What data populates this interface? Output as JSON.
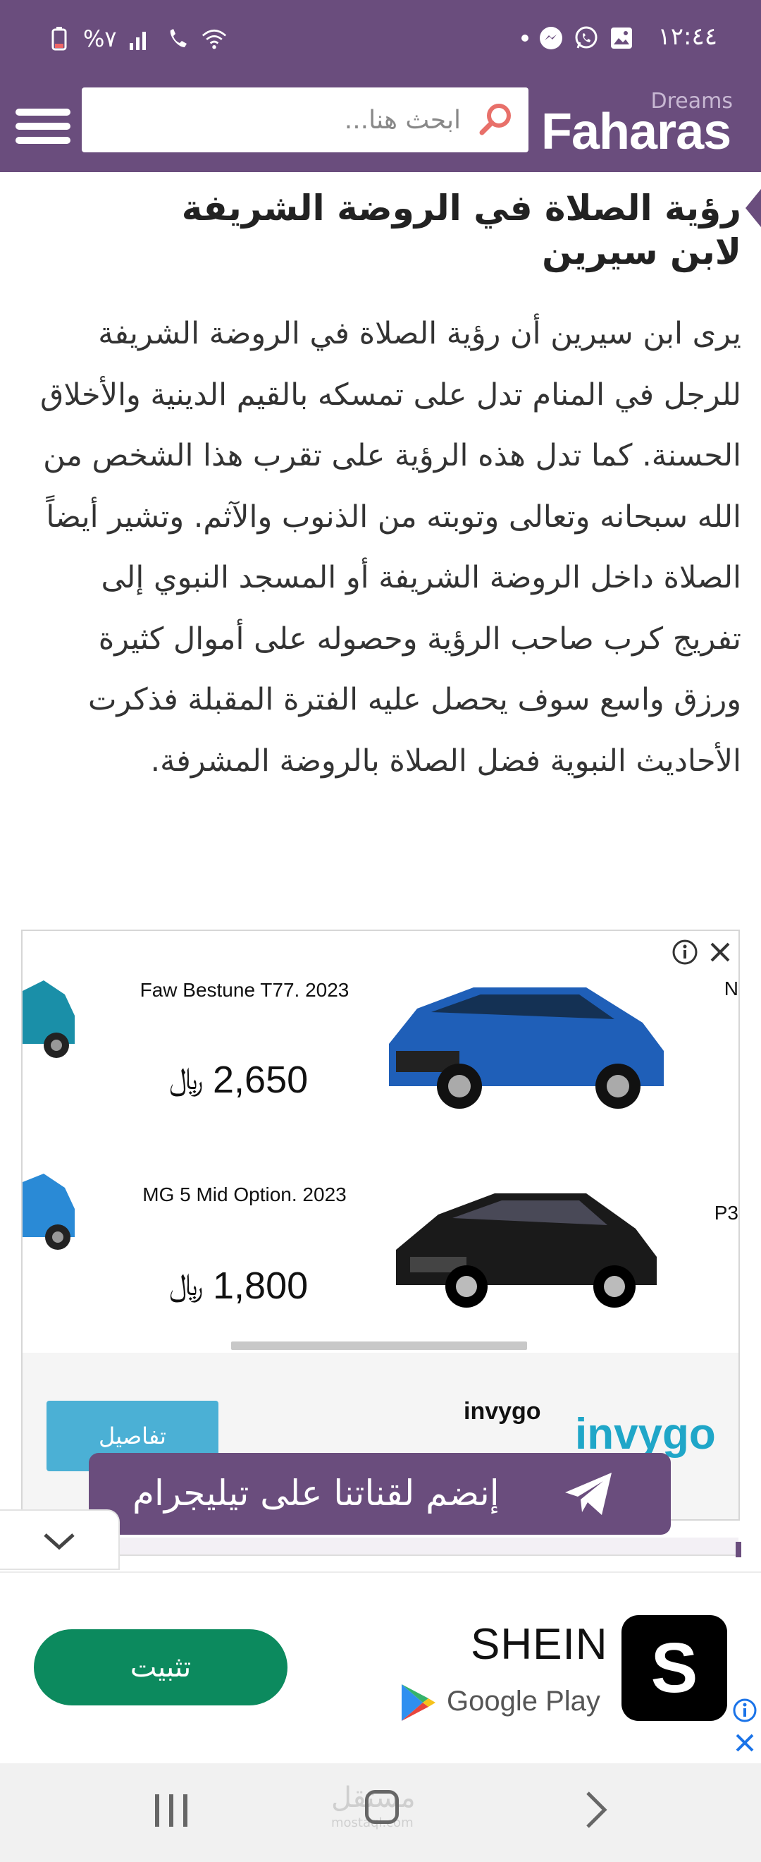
{
  "status_bar": {
    "time": "١٢:٤٤",
    "battery": "%٧",
    "icons": [
      "dot-icon",
      "messenger-icon",
      "whatsapp-icon",
      "gallery-icon",
      "battery-icon",
      "signal-icon",
      "wifi-call-icon",
      "wifi-icon"
    ]
  },
  "header": {
    "search_placeholder": "ابحث هنا...",
    "logo_text": "Faharas",
    "logo_subtext": "Dreams",
    "accent_color": "#6a4d7d"
  },
  "article": {
    "heading": "رؤية الصلاة في الروضة الشريفة لابن سيرين",
    "body": "يرى ابن سيرين أن رؤية الصلاة في الروضة الشريفة للرجل في المنام تدل على تمسكه بالقيم الدينية والأخلاق الحسنة. كما تدل هذه الرؤية على تقرب هذا الشخص من الله سبحانه وتعالى وتوبته من الذنوب والآثم. وتشير أيضاً الصلاة داخل الروضة الشريفة أو المسجد النبوي إلى تفريج كرب صاحب الرؤية وحصوله على أموال كثيرة ورزق واسع سوف يحصل عليه الفترة المقبلة فذكرت الأحاديث النبوية فضل الصلاة بالروضة المشرفة."
  },
  "car_ad": {
    "cars": [
      {
        "title": "Faw Bestune T77. 2023",
        "price": "2,650",
        "currency": "﷼",
        "color": "#1f5fb8"
      },
      {
        "title": "MG 5 Mid Option. 2023",
        "price": "1,800",
        "currency": "﷼",
        "color": "#1a1a1a"
      }
    ],
    "edge_labels": [
      "N",
      "P3"
    ],
    "advertiser": "invygo",
    "advertiser_logo": "invygo",
    "details_button": "تفاصيل",
    "brand_color": "#1fa6c8"
  },
  "telegram_banner": {
    "label": "إنضم لقناتنا على تيليجرام"
  },
  "install_ad": {
    "app_name": "SHEIN",
    "store": "Google Play",
    "install_button": "تثبيت",
    "app_icon_letter": "S",
    "button_color": "#0c8a5e"
  },
  "nav_bar": {
    "watermark": "مستقل",
    "watermark_sub": "mostaql.com"
  }
}
